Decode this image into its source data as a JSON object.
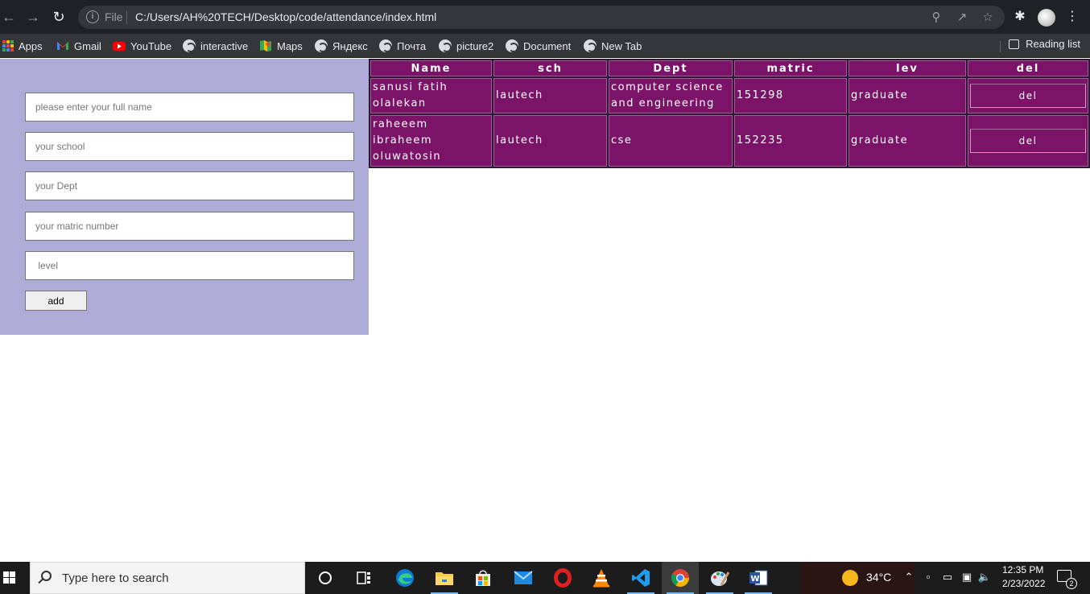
{
  "browser": {
    "url_scheme_label": "File",
    "url": "C:/Users/AH%20TECH/Desktop/code/attendance/index.html",
    "bookmarks": [
      {
        "label": "Apps",
        "icon": "apps-grid-icon"
      },
      {
        "label": "Gmail",
        "icon": "gmail-icon"
      },
      {
        "label": "YouTube",
        "icon": "youtube-icon"
      },
      {
        "label": "interactive",
        "icon": "globe-icon"
      },
      {
        "label": "Maps",
        "icon": "maps-icon"
      },
      {
        "label": "Яндекс",
        "icon": "globe-icon"
      },
      {
        "label": "Почта",
        "icon": "globe-icon"
      },
      {
        "label": "picture2",
        "icon": "globe-icon"
      },
      {
        "label": "Document",
        "icon": "globe-icon"
      },
      {
        "label": "New Tab",
        "icon": "globe-icon"
      }
    ],
    "reading_list": "Reading list"
  },
  "form": {
    "name_placeholder": "please enter your full name",
    "school_placeholder": "your school",
    "dept_placeholder": "your Dept",
    "matric_placeholder": "your matric number",
    "level_placeholder": " level",
    "add_label": "add"
  },
  "table": {
    "headers": [
      "Name",
      "sch",
      "Dept",
      "matric",
      "lev",
      "del"
    ],
    "rows": [
      {
        "name": "sanusi fatih olalekan",
        "sch": "lautech",
        "dept": "computer science and engineering",
        "matric": "151298",
        "lev": "graduate",
        "del": "del"
      },
      {
        "name": "raheeem ibraheem oluwatosin",
        "sch": "lautech",
        "dept": "cse",
        "matric": "152235",
        "lev": "graduate",
        "del": "del"
      }
    ]
  },
  "taskbar": {
    "search_placeholder": "Type here to search",
    "weather": "34°C",
    "time": "12:35 PM",
    "date": "2/23/2022",
    "notification_count": "2"
  },
  "colors": {
    "form_panel_bg": "#aeabd6",
    "table_cell_bg": "#7b1469",
    "chrome_bg": "#202124"
  }
}
